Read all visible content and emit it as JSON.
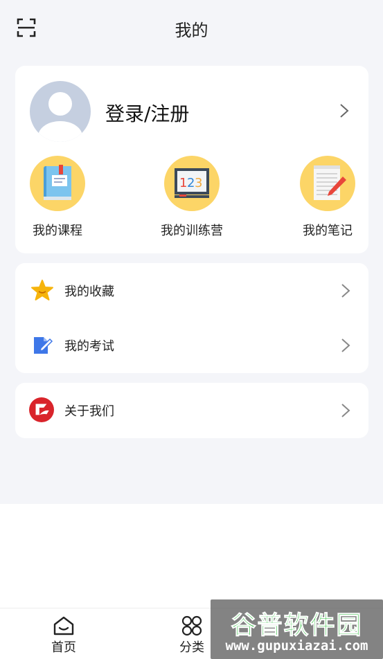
{
  "header": {
    "title": "我的",
    "scan_icon": "scan-icon"
  },
  "profile": {
    "login_label": "登录/注册",
    "avatar_icon": "default-avatar-icon"
  },
  "quick_links": [
    {
      "label": "我的课程",
      "icon": "book-icon"
    },
    {
      "label": "我的训练营",
      "icon": "blackboard-123-icon"
    },
    {
      "label": "我的笔记",
      "icon": "notepad-pencil-icon"
    }
  ],
  "menu": [
    {
      "label": "我的收藏",
      "icon": "star-icon"
    },
    {
      "label": "我的考试",
      "icon": "exam-edit-icon"
    }
  ],
  "about": {
    "label": "关于我们",
    "icon": "brand-logo-icon"
  },
  "tabbar": [
    {
      "label": "首页",
      "icon": "home-icon"
    },
    {
      "label": "分类",
      "icon": "category-grid-icon"
    }
  ],
  "watermark": {
    "title": "谷普软件园",
    "url": "www.gupuxiazai.com"
  },
  "colors": {
    "page_bg": "#f4f5f9",
    "accent_yellow": "#fcd567",
    "star": "#f6b40c",
    "exam_blue": "#3e77e8",
    "brand_red": "#d9242b"
  }
}
